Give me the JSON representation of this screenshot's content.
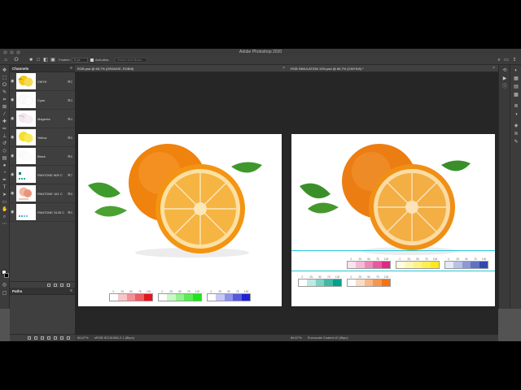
{
  "app": {
    "title": "Adobe Photoshop 2020"
  },
  "options": {
    "feather_label": "Feather:",
    "feather_value": "0 px",
    "anti_alias_label": "Anti-alias",
    "select_mask_label": "Select and Mask..."
  },
  "channels_panel": {
    "title": "Channels",
    "items": [
      {
        "name": "CMYK",
        "key": "⌘2"
      },
      {
        "name": "Cyan",
        "key": "⌘3"
      },
      {
        "name": "Magenta",
        "key": "⌘4"
      },
      {
        "name": "Yellow",
        "key": "⌘5"
      },
      {
        "name": "Black",
        "key": "⌘6"
      },
      {
        "name": "PANTONE 809 C",
        "key": "⌘7"
      },
      {
        "name": "PANTONE 161 C",
        "key": "⌘8"
      },
      {
        "name": "PANTONE 3135 C",
        "key": "⌘9"
      }
    ]
  },
  "paths_panel": {
    "title": "Paths"
  },
  "doc_left": {
    "tab_title": "RGB.psd @ 66,7% (ORANGE, RGB/8)",
    "zoom": "66,67%",
    "profile": "sRGB IEC61966-2.1 (8bpc)",
    "strip_numbers": [
      "0",
      "25",
      "50",
      "75",
      "100"
    ]
  },
  "doc_right": {
    "tab_title": "RGB SIMULATION 13%.psd @ 66,7% (CMYK/8) *",
    "zoom": "66,67%",
    "profile": "Euroscale Coated v2 (8bpc)",
    "strip_numbers": [
      "0",
      "25",
      "50",
      "75",
      "100"
    ]
  },
  "colors": {
    "red_strip": [
      "#ffffff",
      "#f9c5c8",
      "#f58f95",
      "#ef5a63",
      "#e8131f"
    ],
    "green_strip": [
      "#ffffff",
      "#c8f9c6",
      "#90f38d",
      "#59ec55",
      "#1ee61a"
    ],
    "blue_strip": [
      "#ffffff",
      "#c7c8f5",
      "#8f91eb",
      "#5759e0",
      "#1f22d5"
    ],
    "magenta_strip": [
      "#fbe2ef",
      "#f5b9d6",
      "#ed88bb",
      "#e65a9f",
      "#df2a85"
    ],
    "yellow_strip": [
      "#fffbe0",
      "#fff6b3",
      "#fff282",
      "#ffee50",
      "#ffe819"
    ],
    "blue2_strip": [
      "#e6e9f6",
      "#b9c1e6",
      "#8d99d4",
      "#6172c3",
      "#3348b0"
    ],
    "teal_strip": [
      "#ffffff",
      "#bfe8e2",
      "#80d1c4",
      "#40b9a7",
      "#00a28a"
    ],
    "orange_strip": [
      "#ffffff",
      "#fcdcc4",
      "#f9b98a",
      "#f6964f",
      "#f37414"
    ]
  },
  "icons": {
    "tools": [
      "move-tool-icon",
      "marquee-icon",
      "lasso-icon",
      "quick-select-icon",
      "crop-icon",
      "eyedropper-icon",
      "healing-icon",
      "brush-icon",
      "stamp-icon",
      "history-brush-icon",
      "eraser-icon",
      "gradient-icon",
      "blur-icon",
      "dodge-icon",
      "pen-icon",
      "type-icon",
      "path-select-icon",
      "rectangle-icon",
      "hand-icon",
      "zoom-icon"
    ]
  }
}
